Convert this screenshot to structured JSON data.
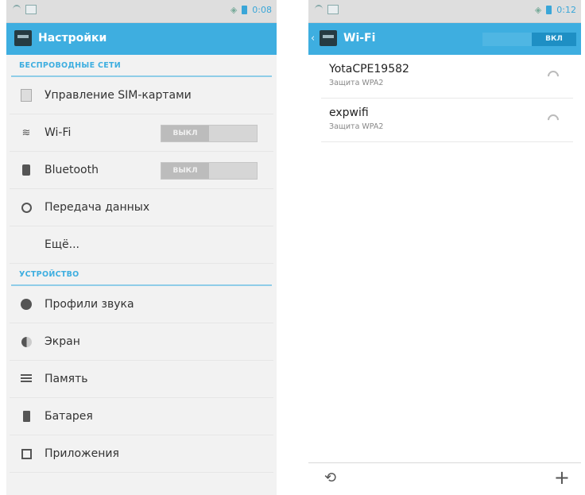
{
  "left": {
    "statusbar": {
      "time": "0:08"
    },
    "actionbar": {
      "title": "Настройки"
    },
    "sections": {
      "wireless": "БЕСПРОВОДНЫЕ СЕТИ",
      "device": "УСТРОЙСТВО"
    },
    "items": {
      "sim": "Управление SIM-картами",
      "wifi": "Wi-Fi",
      "bluetooth": "Bluetooth",
      "data": "Передача данных",
      "more": "Ещё...",
      "sound": "Профили звука",
      "screen": "Экран",
      "memory": "Память",
      "battery": "Батарея",
      "apps": "Приложения"
    },
    "toggles": {
      "wifi_state": "ВЫКЛ",
      "bluetooth_state": "ВЫКЛ"
    }
  },
  "right": {
    "statusbar": {
      "time": "0:12"
    },
    "actionbar": {
      "title": "Wi-Fi",
      "toggle_state": "ВКЛ"
    },
    "networks": [
      {
        "name": "YotaCPE19582",
        "security": "Защита WPA2"
      },
      {
        "name": "expwifi",
        "security": "Защита WPA2"
      }
    ],
    "bottom": {
      "add_symbol": "+"
    }
  },
  "colors": {
    "accent": "#3eaee0",
    "statusbar": "#dedede",
    "background": "#f2f2f2"
  },
  "icons": {
    "left": [
      "wifi-icon",
      "image-icon",
      "volume-icon",
      "battery-icon",
      "settings-icon",
      "sim-icon",
      "wifi-icon",
      "bluetooth-icon",
      "data-usage-icon",
      "sound-profile-icon",
      "display-icon",
      "storage-icon",
      "battery-icon",
      "apps-icon"
    ],
    "right": [
      "wifi-icon",
      "image-icon",
      "volume-icon",
      "battery-icon",
      "settings-icon",
      "signal-icon",
      "scan-icon",
      "add-icon"
    ]
  }
}
